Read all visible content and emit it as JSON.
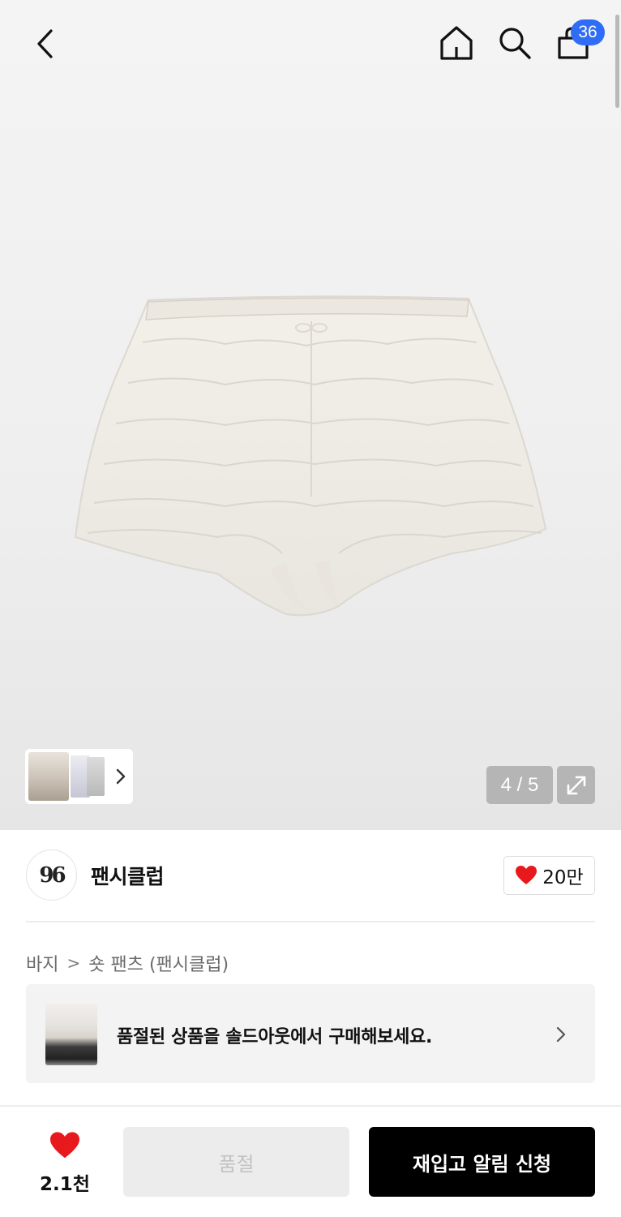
{
  "header": {
    "back_icon": "chevron-left-icon",
    "home_icon": "home-icon",
    "search_icon": "search-icon",
    "cart_icon": "shopping-bag-icon",
    "cart_count": "36",
    "cart_badge_color": "#2f6df6"
  },
  "gallery": {
    "counter": "4 / 5",
    "current_index": 4,
    "total": 5,
    "expand_icon": "expand-icon",
    "thumbnail_icon": "chevron-right-icon"
  },
  "brand": {
    "logo_text": "96",
    "name": "팬시클럽",
    "like_count": "20만",
    "like_icon": "heart-icon"
  },
  "breadcrumb": {
    "category": "바지",
    "separator": ">",
    "subcategory": "숏 팬츠 (팬시클럽)"
  },
  "soldout_banner": {
    "message": "품절된 상품을 솔드아웃에서 구매해보세요.",
    "chevron_icon": "chevron-right-icon"
  },
  "bottom_bar": {
    "wish_count": "2.1천",
    "wish_icon": "heart-icon",
    "wish_color": "#e8191d",
    "soldout_label": "품절",
    "restock_label": "재입고 알림 신청"
  }
}
